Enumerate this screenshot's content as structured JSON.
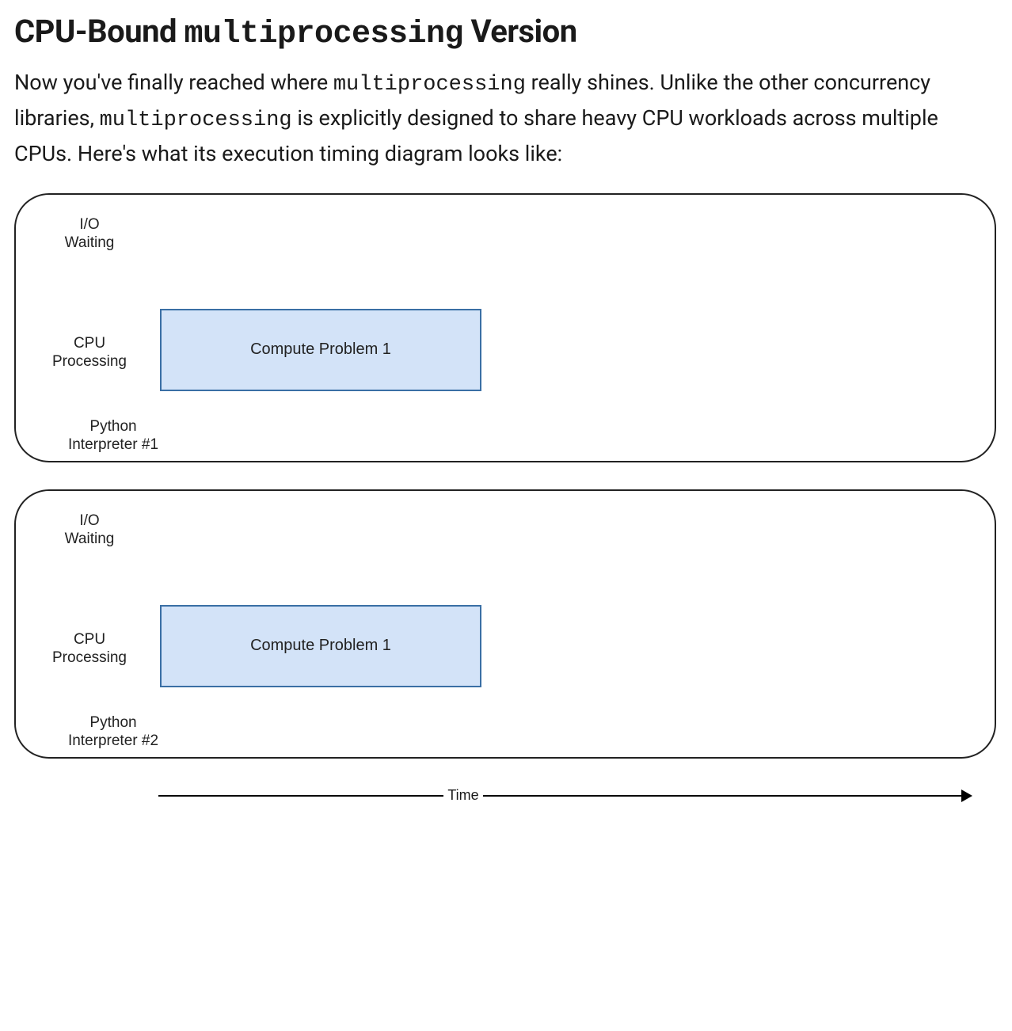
{
  "heading": {
    "pre": "CPU-Bound ",
    "code": "multiprocessing",
    "post": " Version"
  },
  "body": {
    "p1a": "Now you've finally reached where ",
    "p1code1": "multiprocessing",
    "p1b": " really shines. Unlike the other concurrency libraries, ",
    "p1code2": "multiprocessing",
    "p1c": " is explicitly designed to share heavy CPU workloads across multiple CPUs. Here's what its execution timing diagram looks like:"
  },
  "diagram": {
    "row_labels": {
      "io": "I/O\nWaiting",
      "cpu": "CPU\nProcessing"
    },
    "interpreters": [
      {
        "label": "Python\nInterpreter #1",
        "compute_label": "Compute Problem 1"
      },
      {
        "label": "Python\nInterpreter #2",
        "compute_label": "Compute Problem 1"
      }
    ],
    "time_axis_label": "Time"
  }
}
